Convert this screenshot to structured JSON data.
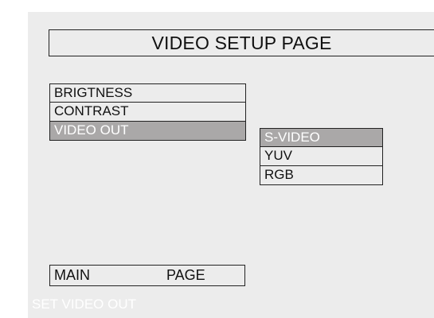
{
  "page": {
    "title": "VIDEO SETUP PAGE"
  },
  "menu": {
    "items": [
      {
        "label": "BRIGTNESS",
        "selected": false
      },
      {
        "label": "CONTRAST",
        "selected": false
      },
      {
        "label": "VIDEO OUT",
        "selected": true
      }
    ]
  },
  "submenu": {
    "items": [
      {
        "label": "S-VIDEO",
        "selected": true
      },
      {
        "label": "YUV",
        "selected": false
      },
      {
        "label": "RGB",
        "selected": false
      }
    ]
  },
  "footer": {
    "left_label": "MAIN",
    "right_label": "PAGE"
  },
  "status": {
    "text": "SET VIDEO OUT"
  },
  "colors": {
    "background": "#ececec",
    "selected_bg": "#aaa8a8",
    "selected_text": "#ffffff",
    "border": "#222222"
  }
}
